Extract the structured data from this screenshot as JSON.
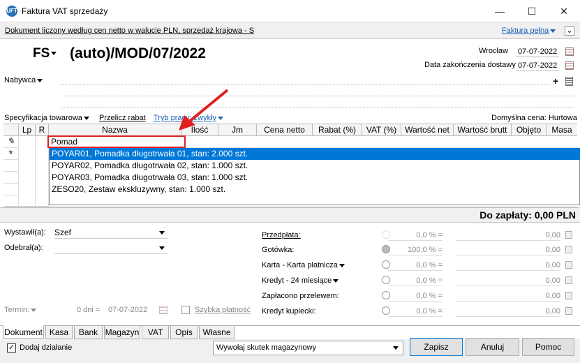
{
  "window": {
    "title": "Faktura VAT sprzedaży",
    "icon_text": "UFT"
  },
  "info": {
    "text": "Dokument liczony według cen netto w walucie PLN, sprzedaż krajowa - S",
    "invoice_type": "Faktura pełna"
  },
  "header": {
    "doc_type": "FS",
    "doc_number": "(auto)/MOD/07/2022",
    "place": "Wrocław",
    "date": "07-07-2022",
    "delivery_label": "Data zakończenia dostawy",
    "delivery_date": "07-07-2022",
    "buyer_label": "Nabywca"
  },
  "toolbar": {
    "spec": "Specyfikacja towarowa",
    "recalc": "Przelicz rabat",
    "mode": "Tryb pracy: zwykły",
    "price": "Domyślna cena: Hurtowa"
  },
  "grid": {
    "columns": [
      "Lp",
      "R",
      "Nazwa",
      "Ilość",
      "Jm",
      "Cena netto",
      "Rabat (%)",
      "VAT (%)",
      "Wartość net",
      "Wartość brutt",
      "Objęto",
      "Masa"
    ],
    "edit_value": "Pomad",
    "suggestions": [
      "POYAR01, Pomadka długotrwała 01, stan: 2.000 szt.",
      "POYAR02, Pomadka długotrwała 02, stan: 1.000 szt.",
      "POYAR03, Pomadka długotrwała 03, stan: 1.000 szt.",
      "ZESO20, Zestaw ekskluzywny, stan: 1.000 szt."
    ]
  },
  "total": {
    "label": "Do zapłaty: 0,00 PLN"
  },
  "bottom": {
    "issued_label": "Wystawił(a):",
    "issued_value": "Szef",
    "received_label": "Odebrał(a):",
    "term_label": "Termin:",
    "term_days": "0 dni =",
    "term_date": "07-07-2022",
    "quick_pay": "Szybka płatność"
  },
  "payments": [
    {
      "label": "Przedpłata:",
      "pct": "0,0 % =",
      "amount": "0,00"
    },
    {
      "label": "Gotówka:",
      "pct": "100,0 % =",
      "amount": "0,00"
    },
    {
      "label": "Karta - Karta płatnicza",
      "pct": "0,0 % =",
      "amount": "0,00"
    },
    {
      "label": "Kredyt - 24 miesiące",
      "pct": "0,0 % =",
      "amount": "0,00"
    },
    {
      "label": "Zapłacono przelewem:",
      "pct": "0,0 % =",
      "amount": "0,00"
    },
    {
      "label": "Kredyt kupiecki:",
      "pct": "0,0 % =",
      "amount": "0,00"
    }
  ],
  "tabs": [
    "Dokument",
    "Kasa",
    "Bank",
    "Magazyn",
    "VAT",
    "Opis",
    "Własne"
  ],
  "footer": {
    "add_action": "Dodaj działanie",
    "stock_effect": "Wywołaj skutek magazynowy",
    "save": "Zapisz",
    "cancel": "Anuluj",
    "help": "Pomoc"
  },
  "colors": {
    "selection": "#0078d7",
    "highlight_border": "#e02020",
    "link": "#1a5fb4"
  }
}
